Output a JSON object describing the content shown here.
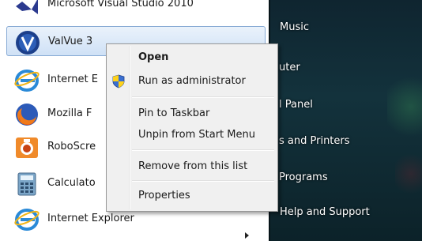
{
  "programs": [
    {
      "label": "Microsoft Visual Studio 2010",
      "icon": "visual-studio-icon"
    },
    {
      "label": "ValVue 3",
      "icon": "valvue-icon"
    },
    {
      "label": "Internet E",
      "icon": "internet-explorer-icon"
    },
    {
      "label": "Mozilla F",
      "icon": "firefox-icon"
    },
    {
      "label": "RoboScre",
      "icon": "roboscreen-icon"
    },
    {
      "label": "Calculato",
      "icon": "calculator-icon"
    },
    {
      "label": "Internet Explorer",
      "icon": "internet-explorer-icon"
    }
  ],
  "right_items": [
    {
      "label": "Music"
    },
    {
      "label": "uter"
    },
    {
      "label": "l Panel"
    },
    {
      "label": "s and Printers"
    },
    {
      "label": "Programs"
    },
    {
      "label": "Help and Support"
    }
  ],
  "context_menu": {
    "open": "Open",
    "run_as_admin": "Run as administrator",
    "pin_taskbar": "Pin to Taskbar",
    "unpin_start": "Unpin from Start Menu",
    "remove_list": "Remove from this list",
    "properties": "Properties"
  },
  "colors": {
    "accent_highlight": "#cfe1f6",
    "right_pane": "#13323c"
  }
}
